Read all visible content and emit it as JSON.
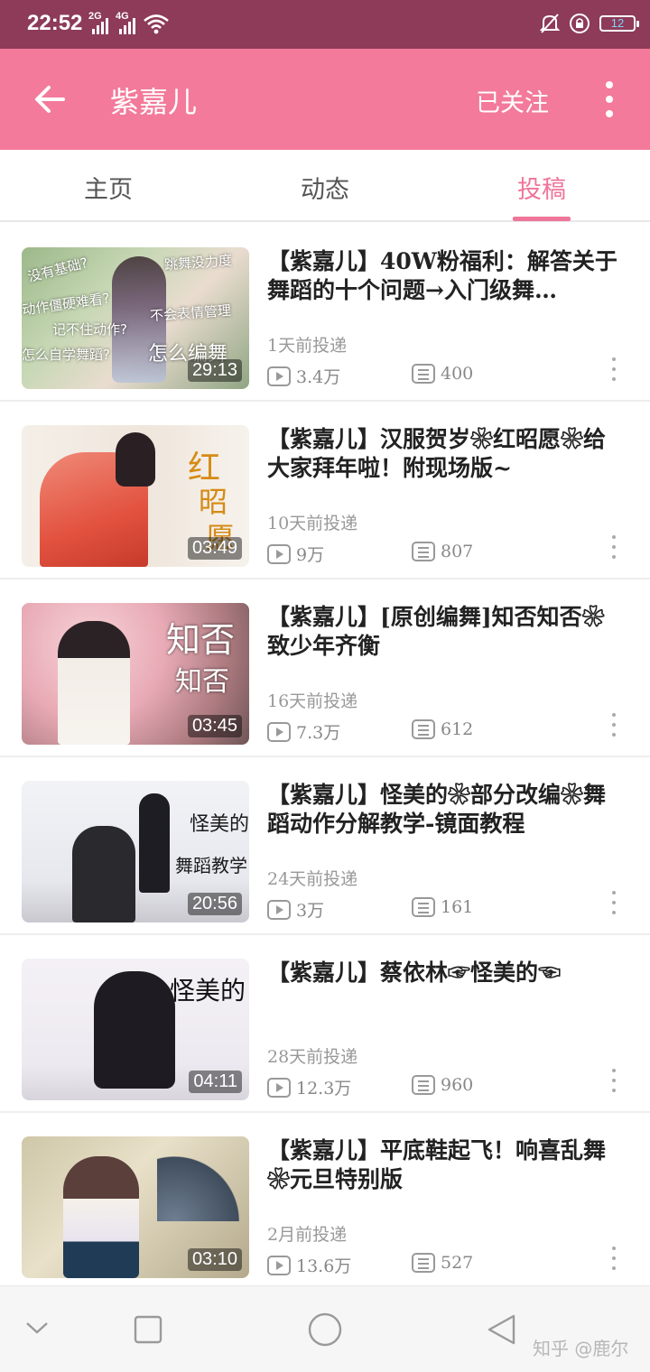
{
  "status_bar": {
    "time": "22:52",
    "network_1": "2G",
    "network_2": "4G",
    "battery": "12"
  },
  "header": {
    "title": "紫嘉儿",
    "follow_label": "已关注"
  },
  "tabs": [
    {
      "label": "主页",
      "active": false
    },
    {
      "label": "动态",
      "active": false
    },
    {
      "label": "投稿",
      "active": true
    }
  ],
  "videos": [
    {
      "title": "【紫嘉儿】40W粉福利：解答关于舞蹈的十个问题→入门级舞…",
      "posted": "1天前投递",
      "plays": "3.4万",
      "comments": "400",
      "duration": "29:13",
      "overlay": [
        "没有基础?",
        "跳舞没力度",
        "动作僵硬难看?",
        "记不住动作?",
        "不会表情管理",
        "怎么自学舞蹈?",
        "怎么编舞"
      ]
    },
    {
      "title": "【紫嘉儿】汉服贺岁❀红昭愿❀给大家拜年啦！附现场版~",
      "posted": "10天前投递",
      "plays": "9万",
      "comments": "807",
      "duration": "03:49",
      "overlay": [
        "红",
        "昭",
        "愿"
      ]
    },
    {
      "title": "【紫嘉儿】[原创编舞]知否知否❀致少年齐衡",
      "posted": "16天前投递",
      "plays": "7.3万",
      "comments": "612",
      "duration": "03:45",
      "overlay": [
        "知否",
        "知否"
      ]
    },
    {
      "title": "【紫嘉儿】怪美的❀部分改编❀舞蹈动作分解教学-镜面教程",
      "posted": "24天前投递",
      "plays": "3万",
      "comments": "161",
      "duration": "20:56",
      "overlay": [
        "怪美的",
        "舞蹈教学"
      ]
    },
    {
      "title": "【紫嘉儿】蔡依林☞怪美的☜",
      "posted": "28天前投递",
      "plays": "12.3万",
      "comments": "960",
      "duration": "04:11",
      "overlay": [
        "怪美的"
      ]
    },
    {
      "title": "【紫嘉儿】平底鞋起飞！响喜乱舞❀元旦特别版",
      "posted": "2月前投递",
      "plays": "13.6万",
      "comments": "527",
      "duration": "03:10",
      "overlay": []
    }
  ],
  "watermark": "知乎 @鹿尔",
  "colors": {
    "status_bar": "#8d3b58",
    "header": "#f37a9a",
    "accent": "#f0759a"
  },
  "icons": {
    "back": "arrow-left-icon",
    "more": "more-vertical-icon",
    "play": "play-icon",
    "comment": "comment-icon"
  }
}
